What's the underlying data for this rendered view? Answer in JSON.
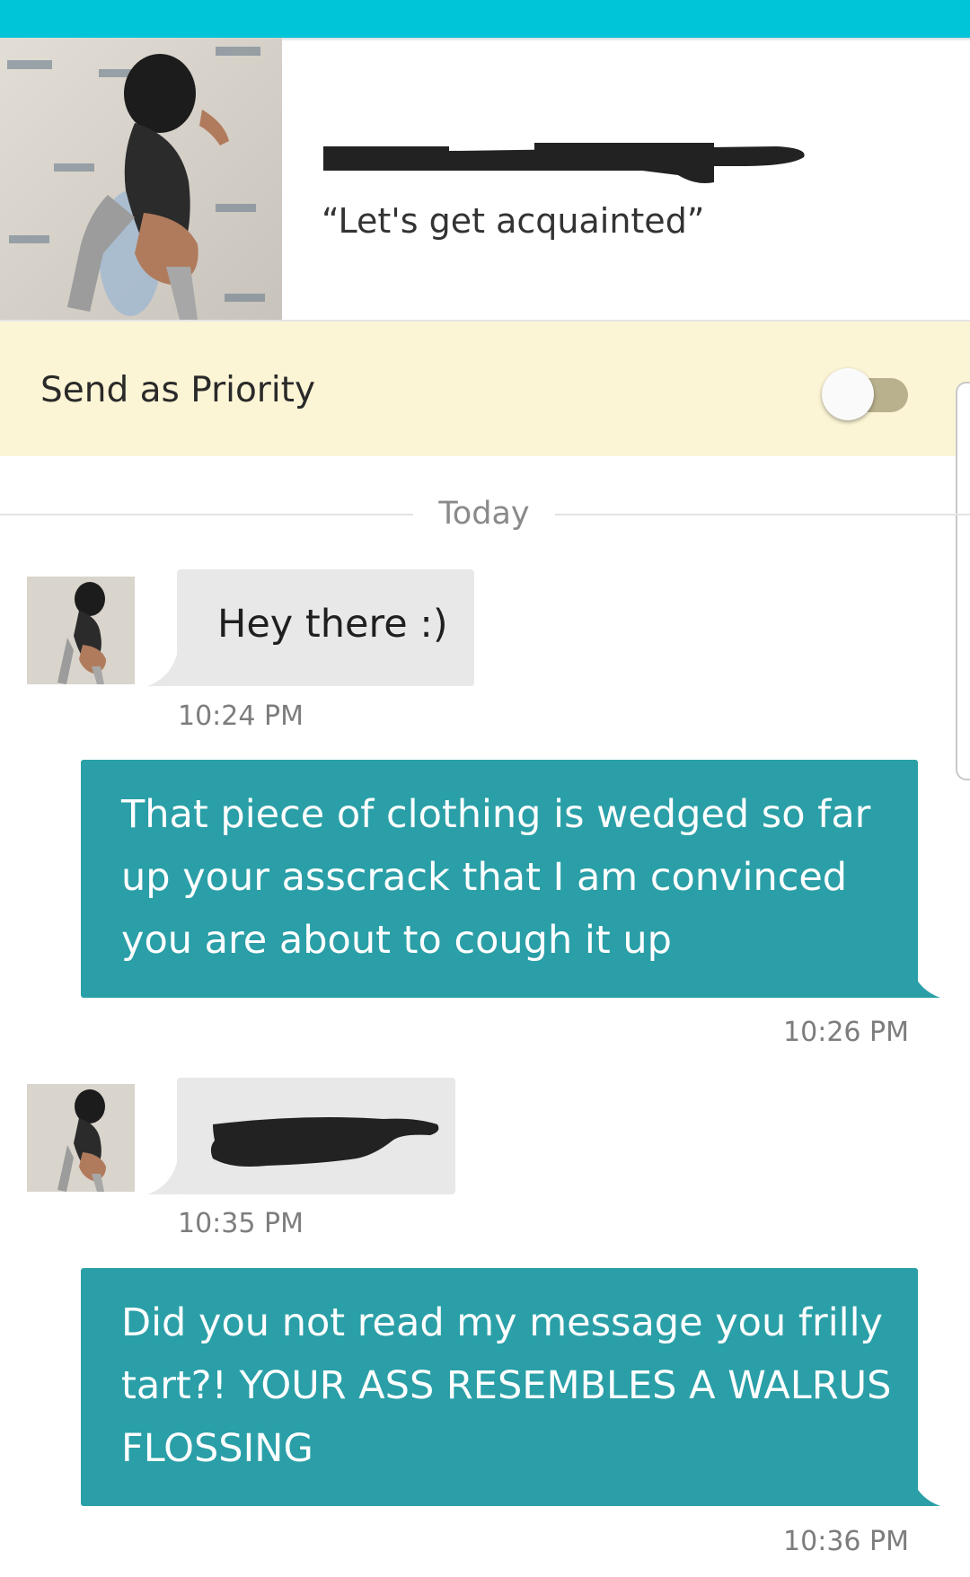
{
  "header": {
    "tagline": "“Let's get acquainted”"
  },
  "priority": {
    "label": "Send as Priority",
    "enabled": false
  },
  "date_divider": "Today",
  "messages": [
    {
      "direction": "incoming",
      "text": "Hey there :)",
      "time": "10:24 PM"
    },
    {
      "direction": "outgoing",
      "text": "That piece of clothing is wedged so far up your asscrack that I am convinced you are about to cough it up",
      "time": "10:26 PM"
    },
    {
      "direction": "incoming",
      "text": "",
      "time": "10:35 PM",
      "redacted": true
    },
    {
      "direction": "outgoing",
      "text": "Did you not read my message you frilly tart?! YOUR ASS RESEMBLES A WALRUS FLOSSING",
      "time": "10:36 PM"
    }
  ],
  "colors": {
    "top_bar": "#00c5d8",
    "priority_background": "#fcf5d5",
    "outgoing_bubble": "#2a9fa7",
    "incoming_bubble": "#e8e8e8",
    "redaction": "#222222"
  },
  "icons": {
    "toggle": "toggle-switch-off"
  }
}
